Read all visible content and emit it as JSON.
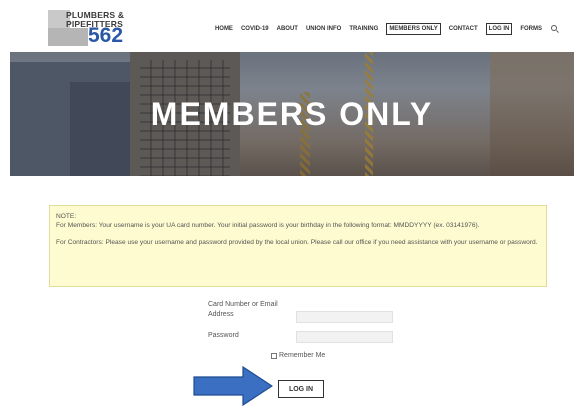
{
  "logo": {
    "line1": "PLUMBERS &",
    "line2": "PIPEFITTERS",
    "number": "562"
  },
  "nav": {
    "items": [
      {
        "label": "HOME",
        "boxed": false
      },
      {
        "label": "COVID-19",
        "boxed": false
      },
      {
        "label": "ABOUT",
        "boxed": false
      },
      {
        "label": "UNION INFO",
        "boxed": false
      },
      {
        "label": "TRAINING",
        "boxed": false
      },
      {
        "label": "MEMBERS ONLY",
        "boxed": true
      },
      {
        "label": "CONTACT",
        "boxed": false
      },
      {
        "label": "LOG IN",
        "boxed": true
      },
      {
        "label": "FORMS",
        "boxed": false
      }
    ],
    "search_icon": "search-icon"
  },
  "hero": {
    "title": "MEMBERS ONLY"
  },
  "note": {
    "heading": "NOTE:",
    "members_text": "For Members: Your username is your UA card number. Your initial password is your birthday in the following format: MMDDYYYY (ex. 03141976).",
    "contractors_text": "For Contractors: Please use your username and password provided by the local union. Please call our office if you need assistance with your username or password."
  },
  "login_form": {
    "username_label": "Card Number or Email Address",
    "username_value": "",
    "password_label": "Password",
    "password_value": "",
    "remember_label": "Remember Me",
    "submit_label": "LOG IN"
  },
  "colors": {
    "logo_blue": "#2a57a6",
    "note_background": "#fdfbcf",
    "arrow_blue": "#3a6fc2"
  }
}
